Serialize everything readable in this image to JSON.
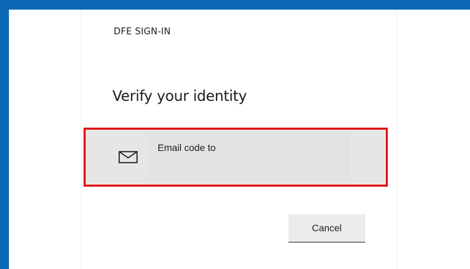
{
  "header": {
    "brand": "DFE SIGN-IN"
  },
  "main": {
    "title": "Verify your identity",
    "options": [
      {
        "label": "Email code to",
        "icon": "envelope-icon"
      }
    ],
    "cancel_label": "Cancel"
  },
  "colors": {
    "frame": "#0b68b7",
    "highlight": "#e01010",
    "option_bg": "#e6e6e6"
  }
}
